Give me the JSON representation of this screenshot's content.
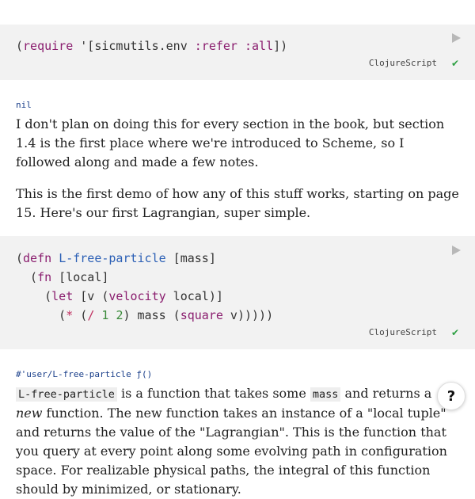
{
  "code_block_1": {
    "code": {
      "p1": "(",
      "require": "require",
      "quote": " '[",
      "ns": "sicmutils.env",
      "refer": ":refer",
      "all": ":all",
      "close": "])"
    },
    "language": "ClojureScript"
  },
  "result_1": "nil",
  "paragraph_1": "I don't plan on doing this for every section in the book, but section 1.4 is the first place where we're introduced to Scheme, so I followed along and made a few notes.",
  "paragraph_2": "This is the first demo of how any of this stuff works, starting on page 15. Here's our first Lagrangian, super simple.",
  "code_block_2": {
    "code": {
      "l1_open": "(",
      "l1_defn": "defn",
      "l1_name": "L-free-particle",
      "l1_args": " [mass]",
      "l2_indent": "  (",
      "l2_fn": "fn",
      "l2_args": " [local]",
      "l3_indent": "    (",
      "l3_let": "let",
      "l3_mid": " [v (",
      "l3_velocity": "velocity",
      "l3_end": " local)]",
      "l4_indent": "      (",
      "l4_mul": "*",
      "l4_p": " (",
      "l4_div": "/",
      "l4_one": "1",
      "l4_two": "2",
      "l4_mid": ") mass (",
      "l4_square": "square",
      "l4_end": " v)))))"
    },
    "language": "ClojureScript"
  },
  "result_2": "#'user/L-free-particle ƒ()",
  "paragraph_3": {
    "code1": "L-free-particle",
    "t1": " is a function that takes some ",
    "code2": "mass",
    "t2": " and returns a ",
    "em": "new",
    "t3": " function. The new function takes an instance of a \"local tuple\" and returns the value of the \"Lagrangian\". This is the function that you query at every point along some evolving path in configuration space. For realizable physical paths, the integral of this function should by minimized, or stationary."
  },
  "help_label": "?",
  "icons": {
    "run": "play-icon",
    "status": "checkmark-icon",
    "help": "question-icon"
  },
  "colors": {
    "code_bg": "#f2f2f2",
    "check": "#2ea043",
    "result": "#1a3f8a"
  }
}
